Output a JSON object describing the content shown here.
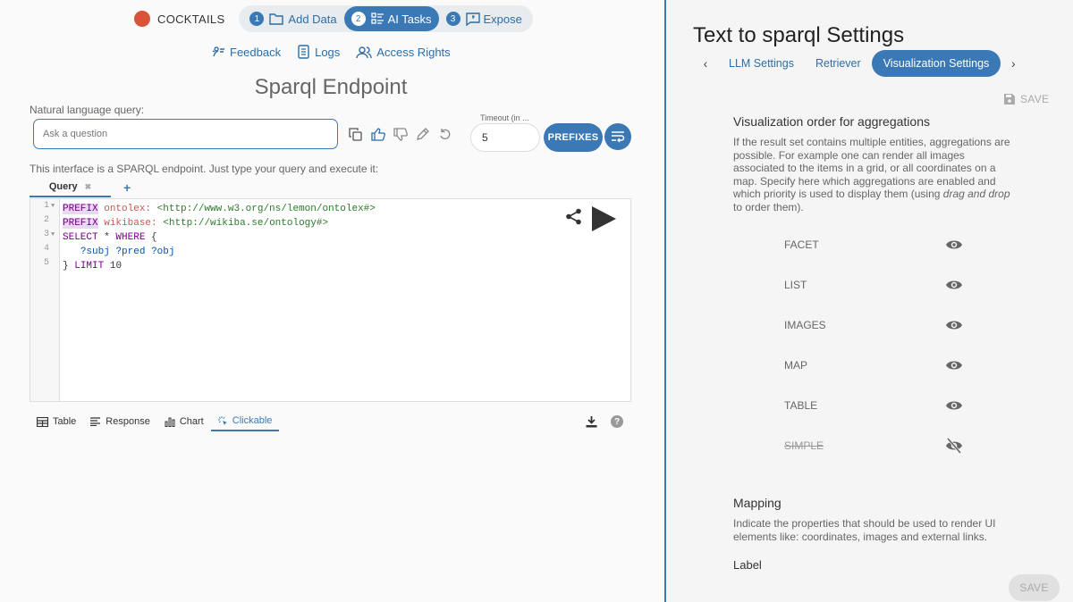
{
  "brand": {
    "name": "COCKTAILS",
    "color": "#d9533a"
  },
  "steps": [
    {
      "num": "1",
      "label": "Add Data",
      "icon": "folder-icon"
    },
    {
      "num": "2",
      "label": "AI Tasks",
      "icon": "tasks-icon"
    },
    {
      "num": "3",
      "label": "Expose",
      "icon": "comment-icon"
    }
  ],
  "subnav": [
    {
      "label": "Feedback",
      "icon": "feedback-icon"
    },
    {
      "label": "Logs",
      "icon": "logs-icon"
    },
    {
      "label": "Access Rights",
      "icon": "users-icon"
    }
  ],
  "page_title": "Sparql Endpoint",
  "nlq": {
    "label": "Natural language query:",
    "placeholder": "Ask a question"
  },
  "timeout": {
    "label": "Timeout (in ...",
    "value": "5"
  },
  "prefixes_label": "PREFIXES",
  "info_text": "This interface is a SPARQL endpoint. Just type your query and execute it:",
  "query_tab": {
    "label": "Query",
    "close": "✖",
    "add": "+"
  },
  "editor": {
    "line_numbers": [
      "1",
      "2",
      "3",
      "4",
      "5"
    ],
    "line1": {
      "kw": "PREFIX",
      "prefix": "ontolex:",
      "iri": "<http://www.w3.org/ns/lemon/ontolex#>"
    },
    "line2": {
      "kw": "PREFIX",
      "prefix": "wikibase:",
      "iri": "<http://wikiba.se/ontology#>"
    },
    "line3": {
      "kw1": "SELECT",
      "op": " * ",
      "kw2": "WHERE",
      "brace": " {"
    },
    "line4": {
      "v1": "?subj",
      "v2": "?pred",
      "v3": "?obj"
    },
    "line5": {
      "brace": "}",
      "kw": "LIMIT",
      "num": "10"
    }
  },
  "result_tabs": [
    {
      "label": "Table",
      "icon": "table-icon"
    },
    {
      "label": "Response",
      "icon": "response-icon"
    },
    {
      "label": "Chart",
      "icon": "chart-icon"
    },
    {
      "label": "Clickable",
      "icon": "clickable-icon"
    }
  ],
  "help_label": "?",
  "settings": {
    "title": "Text to sparql Settings",
    "tabs": [
      "LLM Settings",
      "Retriever",
      "Visualization Settings"
    ],
    "save_label": "SAVE",
    "vis_heading": "Visualization order for aggregations",
    "vis_desc_main": "If the result set contains multiple entities, aggregations are possible. For example one can render all images associated to the items in a grid, or all coordinates on a map. Specify here which aggregations are enabled and which priority is used to display them (using ",
    "vis_desc_em": "drag and drop",
    "vis_desc_end": " to order them).",
    "aggregations": [
      {
        "label": "FACET",
        "enabled": true
      },
      {
        "label": "LIST",
        "enabled": true
      },
      {
        "label": "IMAGES",
        "enabled": true
      },
      {
        "label": "MAP",
        "enabled": true
      },
      {
        "label": "TABLE",
        "enabled": true
      },
      {
        "label": "SIMPLE",
        "enabled": false
      }
    ],
    "mapping_heading": "Mapping",
    "mapping_desc": "Indicate the properties that should be used to render UI elements like: coordinates, images and external links.",
    "label_heading": "Label"
  },
  "colors": {
    "accent": "#3a79b5",
    "link": "#2e6da4"
  }
}
